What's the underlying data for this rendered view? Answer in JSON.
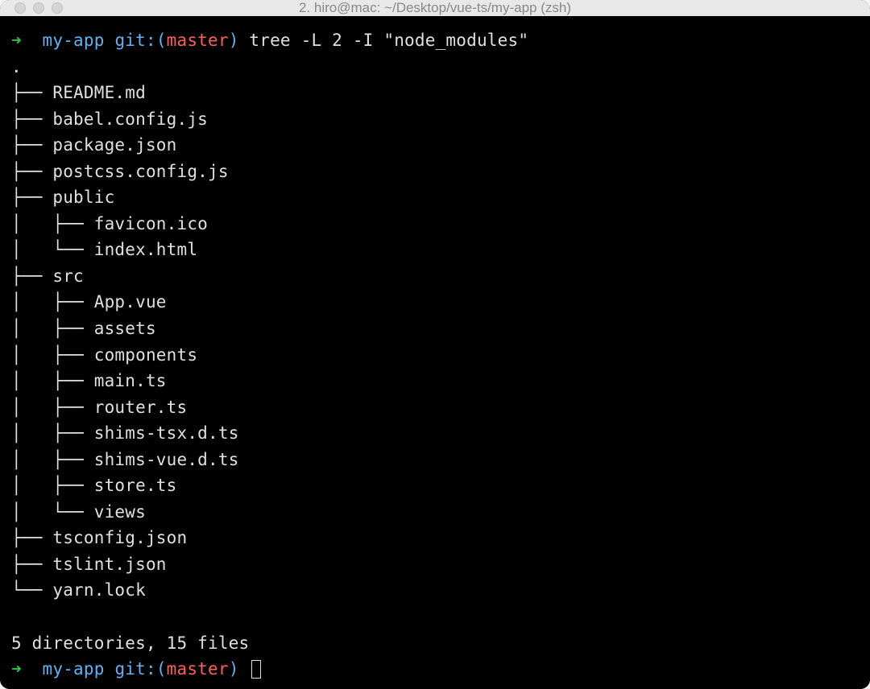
{
  "titlebar": {
    "title": "2. hiro@mac: ~/Desktop/vue-ts/my-app (zsh)"
  },
  "prompt1": {
    "arrow": "➜",
    "path": "my-app",
    "git_label": "git:",
    "paren_open": "(",
    "branch": "master",
    "paren_close": ")",
    "command": "tree -L 2 -I \"node_modules\""
  },
  "tree": {
    "root": ".",
    "lines": [
      "├── README.md",
      "├── babel.config.js",
      "├── package.json",
      "├── postcss.config.js",
      "├── public",
      "│   ├── favicon.ico",
      "│   └── index.html",
      "├── src",
      "│   ├── App.vue",
      "│   ├── assets",
      "│   ├── components",
      "│   ├── main.ts",
      "│   ├── router.ts",
      "│   ├── shims-tsx.d.ts",
      "│   ├── shims-vue.d.ts",
      "│   ├── store.ts",
      "│   └── views",
      "├── tsconfig.json",
      "├── tslint.json",
      "└── yarn.lock"
    ],
    "summary": "5 directories, 15 files"
  },
  "prompt2": {
    "arrow": "➜",
    "path": "my-app",
    "git_label": "git:",
    "paren_open": "(",
    "branch": "master",
    "paren_close": ")"
  }
}
